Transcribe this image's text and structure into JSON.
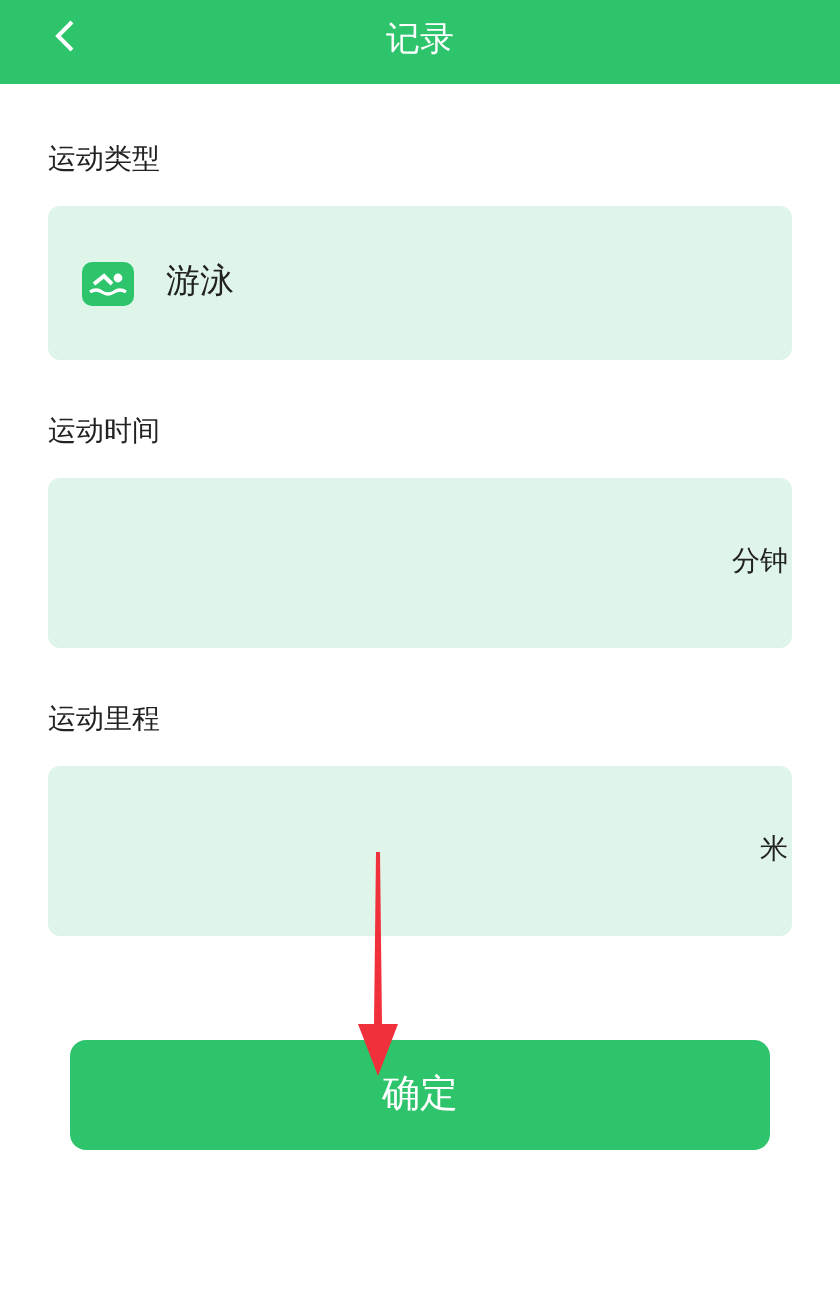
{
  "header": {
    "title": "记录"
  },
  "sections": [
    {
      "kind": "type",
      "label": "运动类型",
      "value": "游泳"
    },
    {
      "kind": "input",
      "label": "运动时间",
      "unit": "分钟"
    },
    {
      "kind": "input",
      "label": "运动里程",
      "unit": "米"
    }
  ],
  "confirm_button": "确定"
}
